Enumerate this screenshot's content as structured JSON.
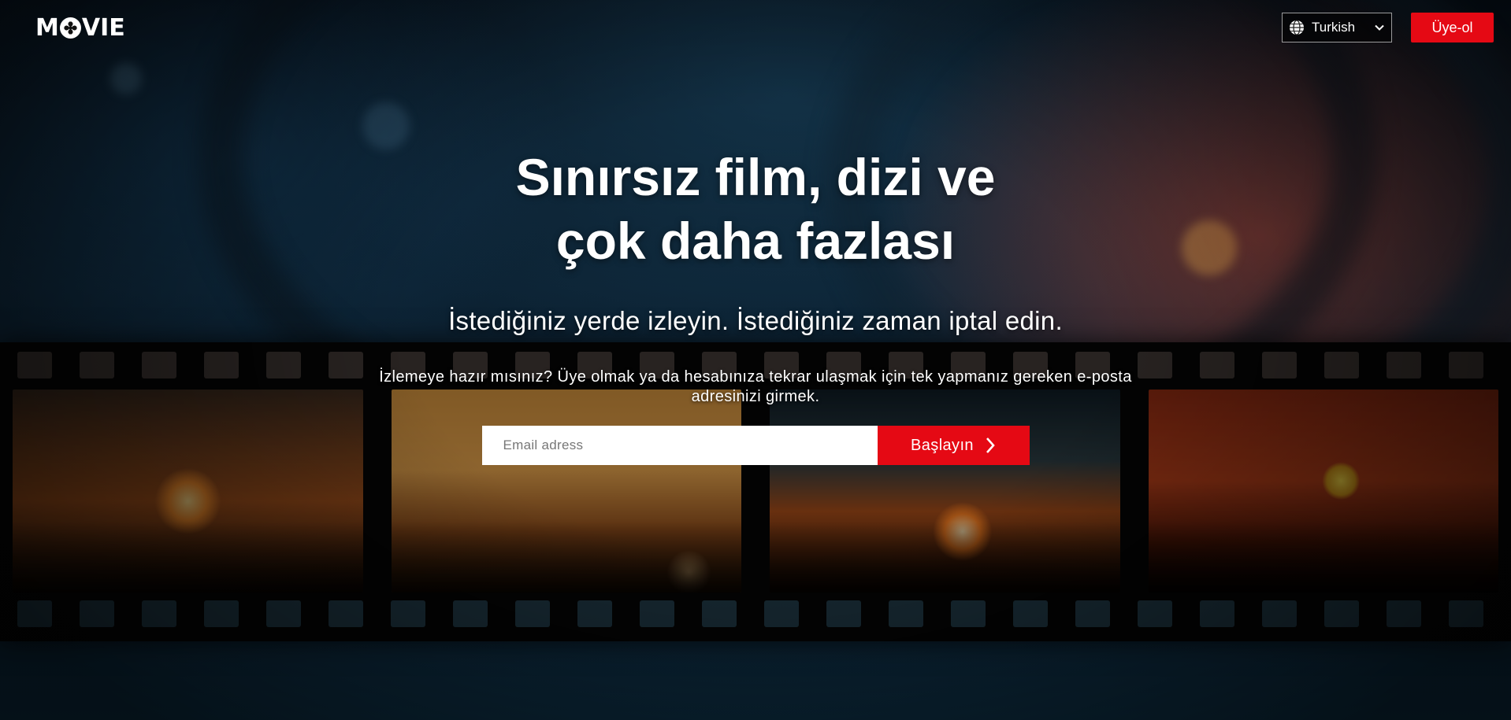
{
  "header": {
    "logo_prefix": "M",
    "logo_suffix": "VIE",
    "language_selected": "Turkish",
    "signup_label": "Üye-ol"
  },
  "hero": {
    "title_line1": "Sınırsız film, dizi ve",
    "title_line2": "çok daha fazlası",
    "subtitle": "İstediğiniz yerde izleyin. İstediğiniz zaman iptal edin.",
    "description": "İzlemeye hazır mısınız? Üye olmak ya da hesabınıza tekrar ulaşmak için tek yapmanız gereken e-posta adresinizi girmek.",
    "email_placeholder": "Email adress",
    "cta_label": "Başlayın"
  },
  "colors": {
    "brand_red": "#e50914",
    "text": "#ffffff"
  },
  "icons": {
    "language": "globe-icon",
    "dropdown": "chevron-down-icon",
    "cta": "chevron-right-icon",
    "logo_o": "film-reel-icon"
  }
}
